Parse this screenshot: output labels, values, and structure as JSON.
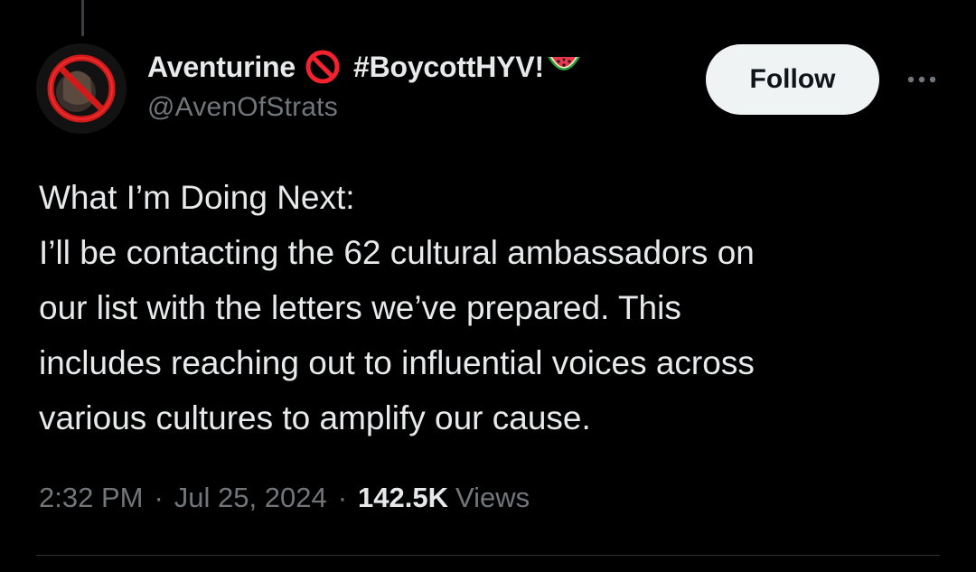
{
  "tweet": {
    "author": {
      "display_name": "Aventurine",
      "status_icon": "no-entry-icon",
      "hashtag": "#BoycottHYV!",
      "trailing_emoji": "watermelon-icon",
      "handle": "@AvenOfStrats"
    },
    "follow_label": "Follow",
    "more_icon": "more-options-icon",
    "text_lines": [
      "What I’m Doing Next:",
      "I’ll be contacting the 62 cultural ambassadors on",
      "our list with the letters we’ve prepared. This",
      "includes reaching out to influential voices across",
      "various cultures to amplify our cause."
    ],
    "meta": {
      "time": "2:32 PM",
      "separator": "·",
      "date": "Jul 25, 2024",
      "views_count": "142.5K",
      "views_label": "Views"
    }
  },
  "colors": {
    "background": "#000000",
    "primary_text": "#e7e9ea",
    "secondary_text": "#71767b",
    "follow_bg": "#eff3f4",
    "follow_text": "#0f1419",
    "no_entry_red": "#f4212e",
    "divider": "#2f3336"
  }
}
